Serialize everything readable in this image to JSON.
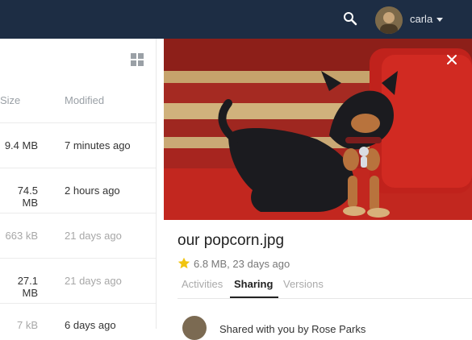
{
  "header": {
    "user_name": "carla",
    "icons": {
      "search": "search-icon",
      "avatar": "user-avatar",
      "caret": "chevron-down-icon"
    }
  },
  "file_list": {
    "columns": {
      "size": "Size",
      "modified": "Modified"
    },
    "rows": [
      {
        "size": "9.4 MB",
        "modified": "7 minutes ago",
        "muted": false
      },
      {
        "size": "74.5 MB",
        "modified": "2 hours ago",
        "muted": false
      },
      {
        "size": "663 kB",
        "modified": "21 days ago",
        "muted": true
      },
      {
        "size": "27.1 MB",
        "modified": "21 days ago",
        "muted": true
      },
      {
        "size": "7 kB",
        "modified": "6 days ago",
        "muted": true
      }
    ],
    "icons": {
      "view_toggle": "grid-view-icon"
    }
  },
  "sidebar": {
    "file_name": "our popcorn.jpg",
    "meta": "6.8 MB, 23 days ago",
    "favorite": true,
    "tabs": [
      {
        "label": "Activities",
        "active": false
      },
      {
        "label": "Sharing",
        "active": true
      },
      {
        "label": "Versions",
        "active": false
      }
    ],
    "shared_with_text": "Shared with you by Rose Parks",
    "icons": {
      "close": "close-icon",
      "star": "star-icon"
    }
  },
  "colors": {
    "header_bg": "#1d2d44",
    "active_tab": "#222222",
    "star": "#f1c40f"
  }
}
